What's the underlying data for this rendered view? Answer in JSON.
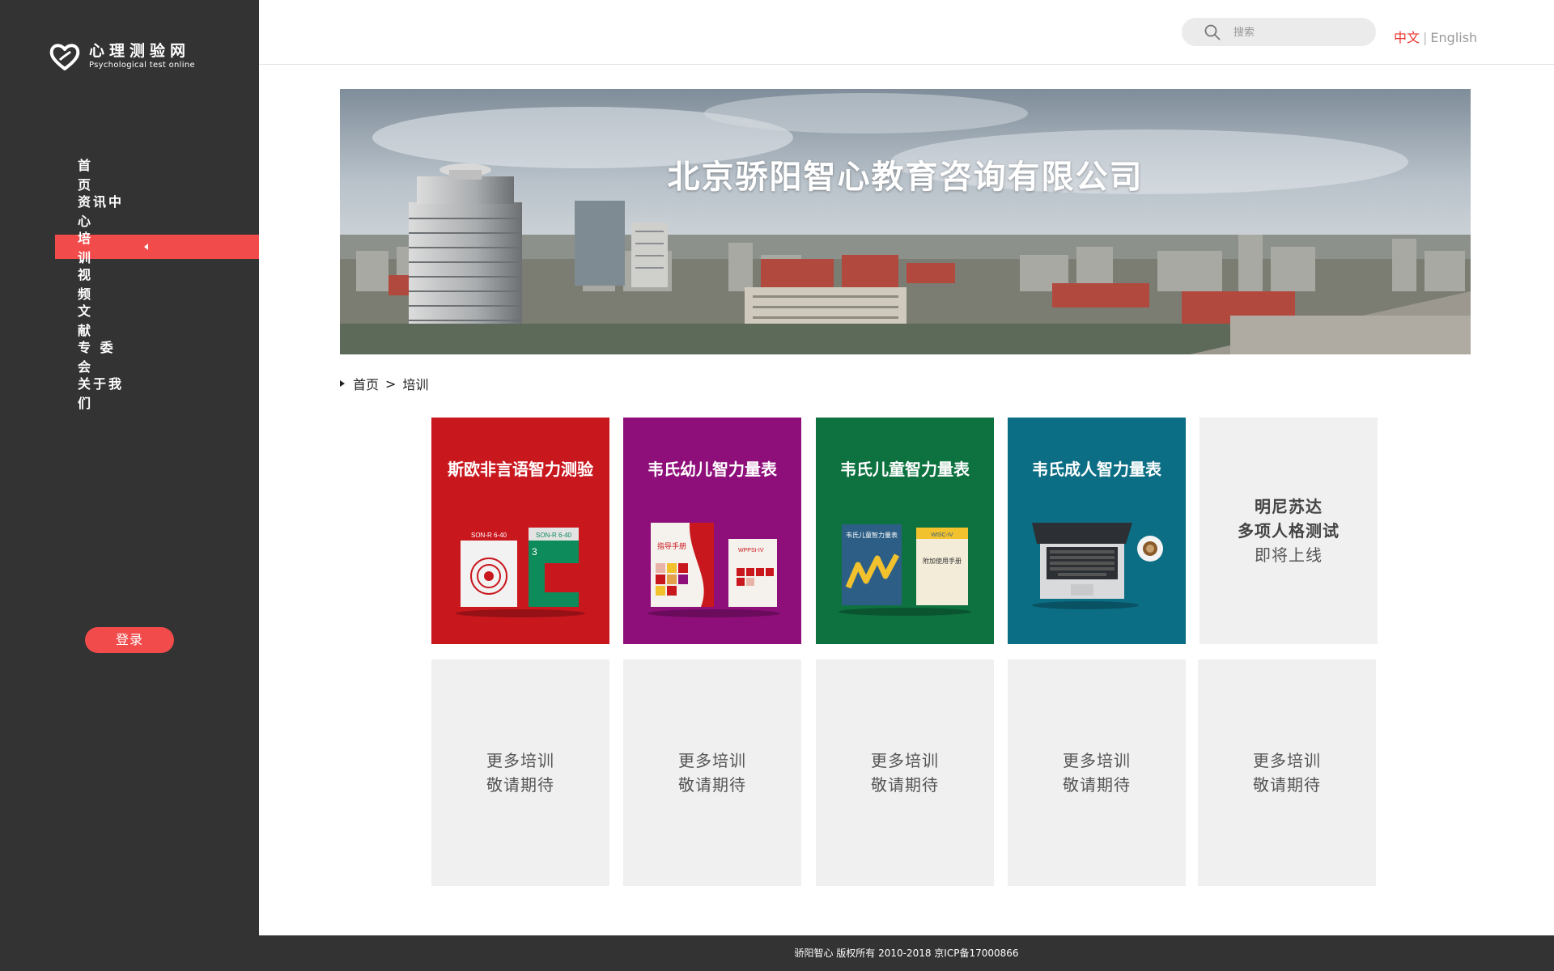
{
  "brand": {
    "name_cn": "心理测验网",
    "name_en": "Psychological test online",
    "color": "#f24b4b"
  },
  "sidebar": {
    "items": [
      {
        "label": "首　　页",
        "active": false
      },
      {
        "label": "资讯中心",
        "active": false
      },
      {
        "label": "培　　训",
        "active": true
      },
      {
        "label": "视　　频",
        "active": false
      },
      {
        "label": "文　　献",
        "active": false
      },
      {
        "label": "专 委 会",
        "active": false
      },
      {
        "label": "关于我们",
        "active": false
      }
    ],
    "login_label": "登录"
  },
  "header": {
    "search_placeholder": "搜索",
    "search_icon": "search-icon",
    "lang_cn": "中文",
    "lang_sep": "|",
    "lang_en": "English"
  },
  "banner": {
    "title": "北京骄阳智心教育咨询有限公司"
  },
  "breadcrumb": {
    "home": "首页",
    "separator": ">",
    "current": "培训"
  },
  "cards": [
    {
      "title": "斯欧非言语智力测验",
      "color": "#c9171e"
    },
    {
      "title": "韦氏幼儿智力量表",
      "color": "#8e0f7a"
    },
    {
      "title": "韦氏儿童智力量表",
      "color": "#0e7240"
    },
    {
      "title": "韦氏成人智力量表",
      "color": "#0b6e84"
    },
    {
      "lines": [
        "明尼苏达",
        "多项人格测试",
        "即将上线"
      ]
    }
  ],
  "placeholders": [
    {
      "line1": "更多培训",
      "line2": "敬请期待"
    },
    {
      "line1": "更多培训",
      "line2": "敬请期待"
    },
    {
      "line1": "更多培训",
      "line2": "敬请期待"
    },
    {
      "line1": "更多培训",
      "line2": "敬请期待"
    },
    {
      "line1": "更多培训",
      "line2": "敬请期待"
    }
  ],
  "book_labels": {
    "son_a": "SON-R 6-40",
    "son_b": "SON-R 6-40",
    "son_num": "3",
    "wppsi_manual": "指导手册",
    "wppsi_tag": "WPPSI-IV",
    "wisc_cover": "韦氏儿童智力量表",
    "wisc_manual": "附加使用手册",
    "wisc_tag": "WISC-IV"
  },
  "footer": {
    "text": "骄阳智心  版权所有  2010-2018  京ICP备17000866"
  }
}
